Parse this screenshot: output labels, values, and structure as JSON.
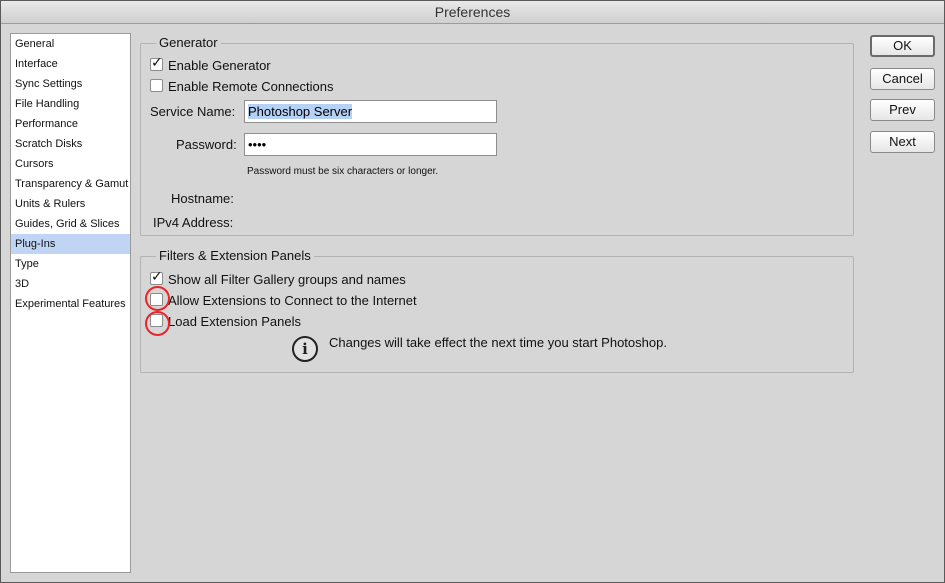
{
  "window": {
    "title": "Preferences"
  },
  "sidebar": {
    "items": [
      {
        "label": "General"
      },
      {
        "label": "Interface"
      },
      {
        "label": "Sync Settings"
      },
      {
        "label": "File Handling"
      },
      {
        "label": "Performance"
      },
      {
        "label": "Scratch Disks"
      },
      {
        "label": "Cursors"
      },
      {
        "label": "Transparency & Gamut"
      },
      {
        "label": "Units & Rulers"
      },
      {
        "label": "Guides, Grid & Slices"
      },
      {
        "label": "Plug-Ins",
        "selected": true
      },
      {
        "label": "Type"
      },
      {
        "label": "3D"
      },
      {
        "label": "Experimental Features"
      }
    ]
  },
  "generator": {
    "title": "Generator",
    "enable_generator": {
      "label": "Enable Generator",
      "checked": true
    },
    "enable_remote": {
      "label": "Enable Remote Connections",
      "checked": false
    },
    "service_name_label": "Service Name:",
    "service_name_value": "Photoshop Server",
    "password_label": "Password:",
    "password_value": "••••",
    "password_hint": "Password must be six characters or longer.",
    "hostname_label": "Hostname:",
    "ipv4_label": "IPv4 Address:"
  },
  "filters": {
    "title": "Filters & Extension Panels",
    "show_all": {
      "label": "Show all Filter Gallery groups and names",
      "checked": true
    },
    "allow_ext": {
      "label": "Allow Extensions to Connect to the Internet",
      "checked": false
    },
    "load_panels": {
      "label": "Load Extension Panels",
      "checked": false
    },
    "info_glyph": "i",
    "info_message": "Changes will take effect the next time you start Photoshop."
  },
  "buttons": {
    "ok": "OK",
    "cancel": "Cancel",
    "prev": "Prev",
    "next": "Next"
  },
  "icons": {
    "checkmark": "✓",
    "info": "info-icon"
  },
  "colors": {
    "selection": "#c0d4f4",
    "annotation": "#e8252a"
  }
}
